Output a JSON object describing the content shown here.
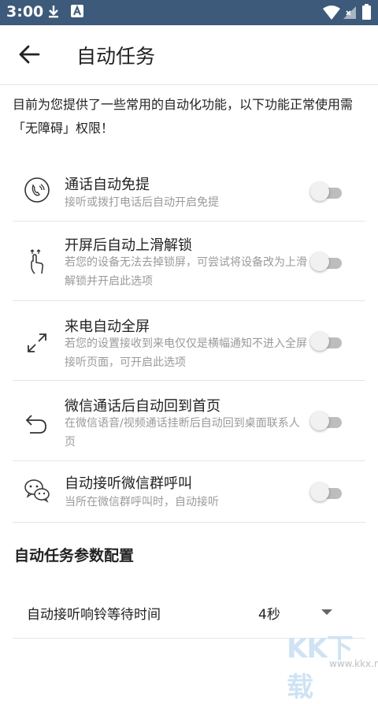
{
  "status_bar": {
    "time": "3:00"
  },
  "app_bar": {
    "title": "自动任务"
  },
  "intro": "目前为您提供了一些常用的自动化功能，以下功能正常使用需「无障碍」权限！",
  "items": [
    {
      "title": "通话自动免提",
      "desc": "接听或拨打电话后自动开启免提",
      "enabled": false
    },
    {
      "title": "开屏后自动上滑解锁",
      "desc": "若您的设备无法去掉锁屏，可尝试将设备改为上滑解锁并开启此选项",
      "enabled": false
    },
    {
      "title": "来电自动全屏",
      "desc": "若您的设置接收到来电仅仅是横幅通知不进入全屏接听页面，可开启此选项",
      "enabled": false
    },
    {
      "title": "微信通话后自动回到首页",
      "desc": "在微信语音/视频通话挂断后自动回到桌面联系人页",
      "enabled": false
    },
    {
      "title": "自动接听微信群呼叫",
      "desc": "当所在微信群呼叫时，自动接听",
      "enabled": false
    }
  ],
  "section_title": "自动任务参数配置",
  "setting": {
    "label": "自动接听响铃等待时间",
    "value": "4秒"
  },
  "watermark": {
    "big": "KK下载",
    "small": "www.kkx.net"
  }
}
